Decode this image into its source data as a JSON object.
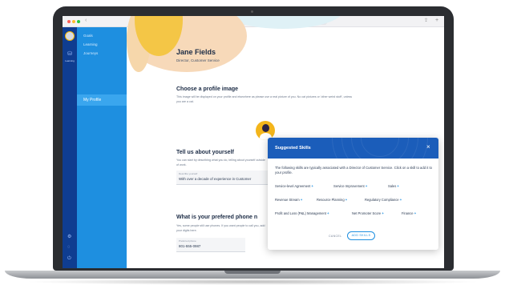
{
  "browser": {
    "back_glyph": "‹",
    "url": "www.company.workaboard.com",
    "share_glyph": "⇪",
    "newtab_glyph": "+"
  },
  "rail": {
    "top_label": "",
    "learning_label": "Learning"
  },
  "sidebar": {
    "items": [
      {
        "label": "Goals"
      },
      {
        "label": "Learning"
      },
      {
        "label": "Journeys"
      }
    ],
    "active_label": "My Profile"
  },
  "profile": {
    "name": "Jane Fields",
    "role": "Director, Customer Service"
  },
  "image_section": {
    "title": "Choose a profile image",
    "desc": "This image will be displayed on your profile and elsewhere as please use a real picture of you. No cat pictures or 'other weird stuff', unless you are a cat."
  },
  "about_section": {
    "title": "Tell us about yourself",
    "desc": "You can start by describing what you do, telling about yourself outside of work.",
    "field_label": "Describe yourself",
    "field_value": "With over a decade of experience in Customer"
  },
  "phone_section": {
    "title": "What is your prefered phone n",
    "desc": "Yes, some people still use phones. If you want people to call you, add your digits here.",
    "field_label": "Preferred phone",
    "field_value": "801-555-0987"
  },
  "modal": {
    "title": "Suggested Skills",
    "close_glyph": "×",
    "description": "The following skills are typically associated with a Director of Customer Service. Click on a skill to add it to your profile.",
    "plus_glyph": "+",
    "skills_row1": [
      "Service-level Agreement",
      "Service Improvement",
      "Sales"
    ],
    "skills_row2": [
      "Revenue Stream",
      "Resource Planning",
      "Regulatory Compliance"
    ],
    "skills_row3": [
      "Profit and Loss (P&L) Management",
      "Net Promoter Score",
      "Finance"
    ],
    "cancel_label": "CANCEL",
    "add_label": "ADD SKILLS"
  },
  "colors": {
    "rail": "#0f3d91",
    "sidebar": "#1e8fe0",
    "modal_header": "#1b5dba",
    "accent": "#1e8fe0"
  }
}
